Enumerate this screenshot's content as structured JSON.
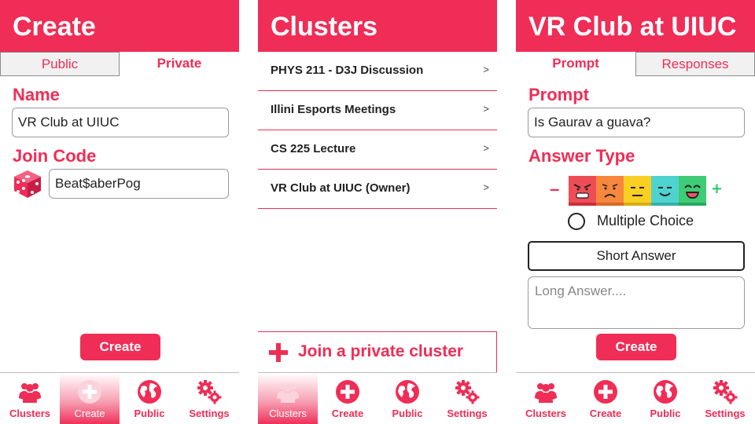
{
  "colors": {
    "accent": "#ef2d56",
    "green": "#3fcc76",
    "text": "#222222"
  },
  "nav": {
    "items": [
      {
        "label": "Clusters",
        "icon": "users-icon"
      },
      {
        "label": "Create",
        "icon": "plus-circle-icon"
      },
      {
        "label": "Public",
        "icon": "globe-icon"
      },
      {
        "label": "Settings",
        "icon": "gears-icon"
      }
    ]
  },
  "create_screen": {
    "title": "Create",
    "tabs": [
      "Public",
      "Private"
    ],
    "active_tab": "Private",
    "name_label": "Name",
    "name_value": "VR Club at UIUC",
    "join_code_label": "Join Code",
    "join_code_value": "Beat$aberPog",
    "dice_icon": "dice-icon",
    "create_button": "Create",
    "active_nav": "Create"
  },
  "clusters_screen": {
    "title": "Clusters",
    "items": [
      {
        "label": "PHYS 211 - D3J Discussion",
        "chevron": ">"
      },
      {
        "label": "Illini Esports Meetings",
        "chevron": ">"
      },
      {
        "label": "CS 225 Lecture",
        "chevron": ">"
      },
      {
        "label": "VR Club at UIUC (Owner)",
        "chevron": ">"
      }
    ],
    "join_label": "Join a private cluster",
    "active_nav": "Clusters"
  },
  "cluster_detail_screen": {
    "title": "VR Club at UIUC",
    "tabs": [
      "Prompt",
      "Responses"
    ],
    "active_tab": "Prompt",
    "prompt_label": "Prompt",
    "prompt_value": "Is Gaurav a guava?",
    "answer_type_label": "Answer Type",
    "scale_minus": "–",
    "scale_plus": "+",
    "faces": [
      {
        "icon": "angry-face-icon",
        "color": "#ef4d56"
      },
      {
        "icon": "frown-face-icon",
        "color": "#f6873d"
      },
      {
        "icon": "neutral-face-icon",
        "color": "#f9cf24"
      },
      {
        "icon": "smile-face-icon",
        "color": "#4fd3cf"
      },
      {
        "icon": "grin-face-icon",
        "color": "#3fcc76"
      }
    ],
    "multiple_choice_label": "Multiple Choice",
    "short_answer_label": "Short Answer",
    "long_answer_placeholder": "Long Answer....",
    "create_button": "Create",
    "active_nav": "none"
  }
}
